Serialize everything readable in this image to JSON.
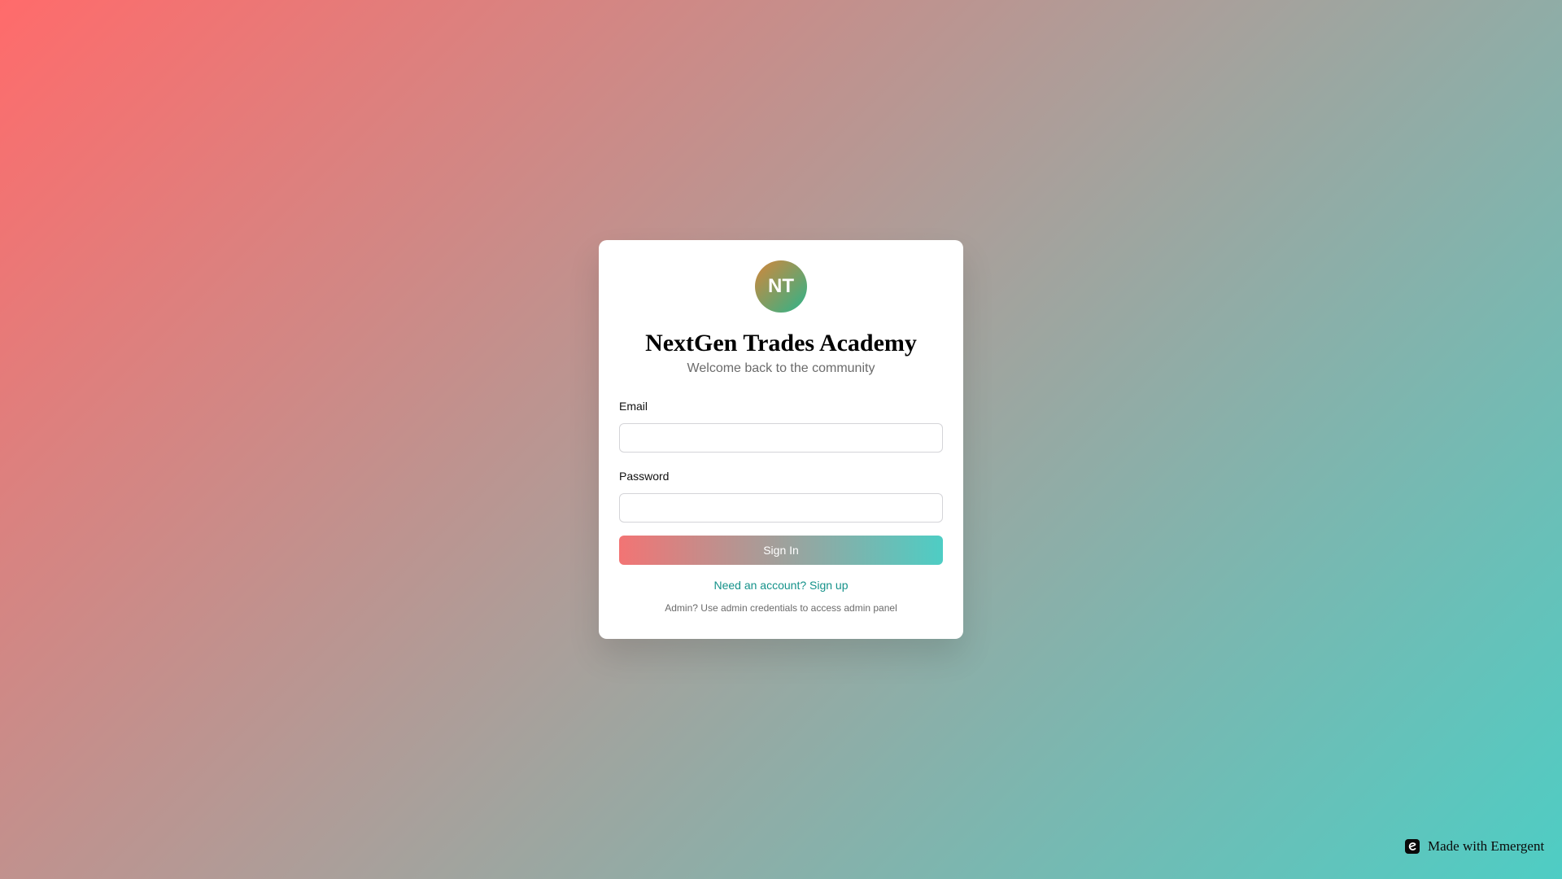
{
  "brand": {
    "logo_initials": "NT",
    "title": "NextGen Trades Academy",
    "subtitle": "Welcome back to the community"
  },
  "form": {
    "email_label": "Email",
    "email_value": "",
    "password_label": "Password",
    "password_value": "",
    "signin_label": "Sign In",
    "signup_link": "Need an account? Sign up",
    "admin_note": "Admin? Use admin credentials to access admin panel"
  },
  "footer": {
    "badge_text": "Made with Emergent",
    "badge_icon": "emergent-logo-icon"
  },
  "colors": {
    "background_start": "#ff6b6b",
    "background_end": "#4ecdc4",
    "link": "#15928a",
    "logo_start": "#d4863a",
    "logo_end": "#2db48a"
  }
}
